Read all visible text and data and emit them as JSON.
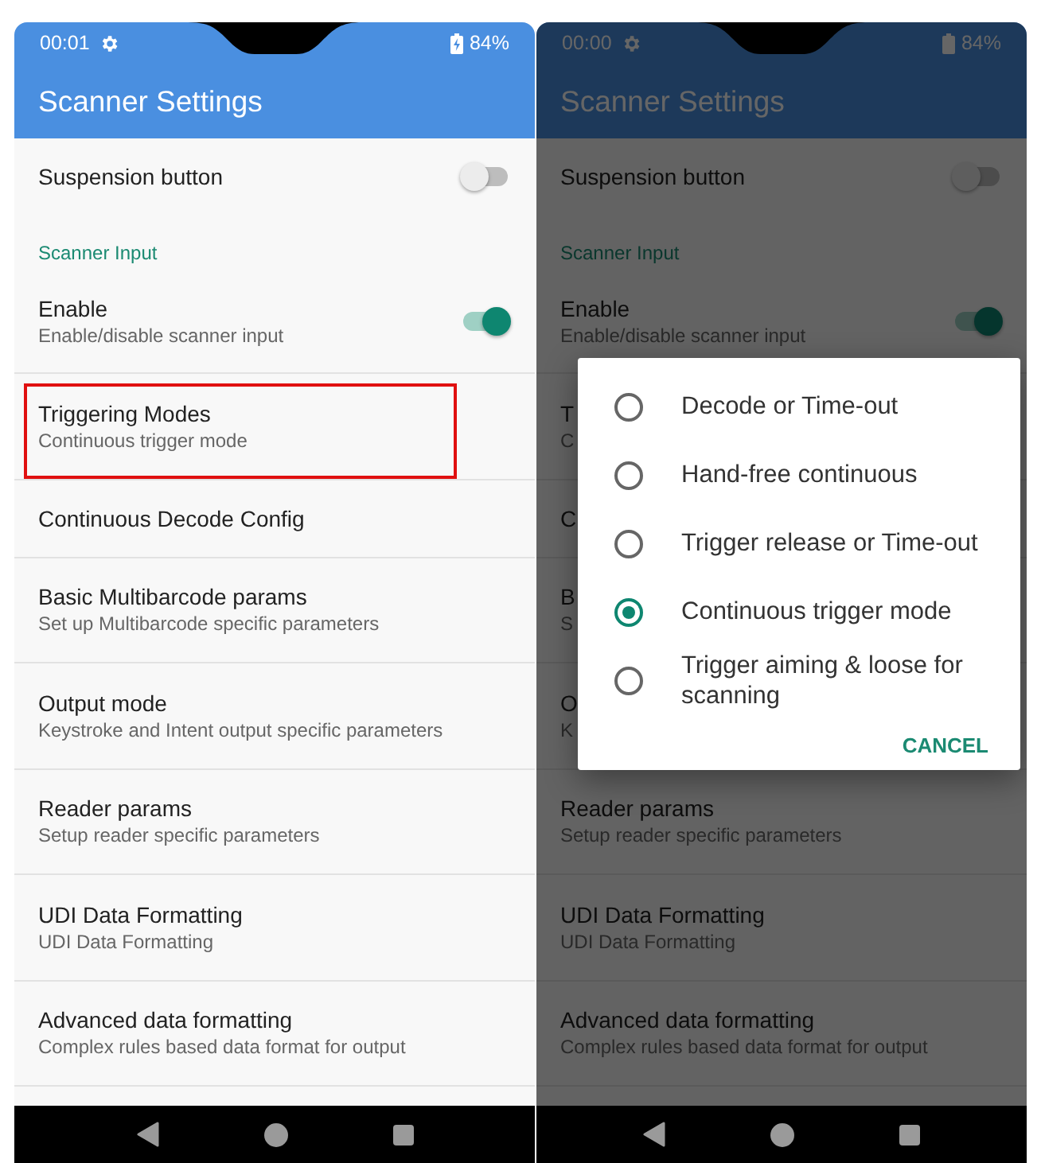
{
  "screens": [
    {
      "status_bar": {
        "time": "00:01",
        "battery": "84%",
        "charging": true
      },
      "app_bar": {
        "title": "Scanner Settings"
      },
      "dimmed": false,
      "settings": [
        {
          "kind": "toggle",
          "title": "Suspension button",
          "on": false
        },
        {
          "kind": "header",
          "title": "Scanner Input"
        },
        {
          "kind": "toggle",
          "title": "Enable",
          "subtitle": "Enable/disable scanner input",
          "on": true
        },
        {
          "kind": "item",
          "title": "Triggering Modes",
          "subtitle": "Continuous trigger mode",
          "highlighted": true
        },
        {
          "kind": "item",
          "title": "Continuous Decode Config",
          "highlighted": false
        },
        {
          "kind": "item",
          "title": "Basic Multibarcode params",
          "subtitle": "Set up Multibarcode specific parameters",
          "highlighted": false
        },
        {
          "kind": "item",
          "title": "Output mode",
          "subtitle": "Keystroke and Intent output specific parameters",
          "highlighted": false
        },
        {
          "kind": "item",
          "title": "Reader params",
          "subtitle": "Setup reader specific parameters",
          "highlighted": false
        },
        {
          "kind": "item",
          "title": "UDI Data Formatting",
          "subtitle": "UDI Data Formatting",
          "highlighted": false
        },
        {
          "kind": "item",
          "title": "Advanced data formatting",
          "subtitle": "Complex rules based data format for output",
          "highlighted": false
        }
      ]
    },
    {
      "status_bar": {
        "time": "00:00",
        "battery": "84%",
        "charging": false
      },
      "app_bar": {
        "title": "Scanner Settings"
      },
      "dimmed": true,
      "settings": [
        {
          "kind": "toggle",
          "title": "Suspension button",
          "on": false
        },
        {
          "kind": "header",
          "title": "Scanner Input"
        },
        {
          "kind": "toggle",
          "title": "Enable",
          "subtitle": "Enable/disable scanner input",
          "on": true
        },
        {
          "kind": "item",
          "title": "T",
          "subtitle": "C",
          "highlighted": false
        },
        {
          "kind": "item",
          "title": "C",
          "highlighted": false
        },
        {
          "kind": "item",
          "title": "B",
          "subtitle": "S",
          "highlighted": false
        },
        {
          "kind": "item",
          "title": "O",
          "subtitle": "K",
          "highlighted": false
        },
        {
          "kind": "item",
          "title": "Reader params",
          "subtitle": "Setup reader specific parameters",
          "highlighted": false
        },
        {
          "kind": "item",
          "title": "UDI Data Formatting",
          "subtitle": "UDI Data Formatting",
          "highlighted": false
        },
        {
          "kind": "item",
          "title": "Advanced data formatting",
          "subtitle": "Complex rules based data format for output",
          "highlighted": false
        }
      ],
      "dialog": {
        "options": [
          {
            "label": "Decode or Time-out",
            "selected": false
          },
          {
            "label": "Hand-free continuous",
            "selected": false
          },
          {
            "label": "Trigger release or Time-out",
            "selected": false
          },
          {
            "label": "Continuous trigger mode",
            "selected": true
          },
          {
            "label": "Trigger aiming & loose for scanning",
            "selected": false
          }
        ],
        "cancel": "CANCEL"
      }
    }
  ]
}
